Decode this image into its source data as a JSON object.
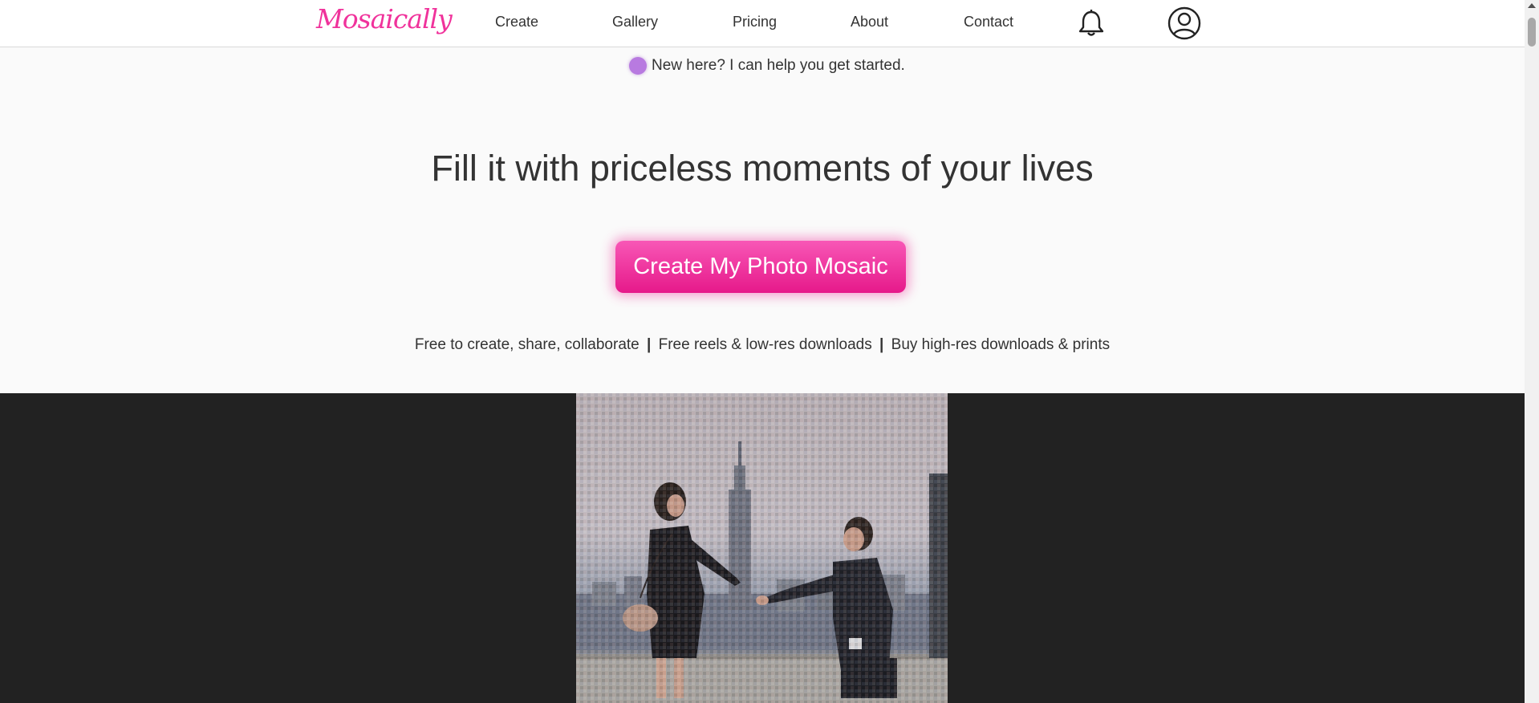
{
  "header": {
    "logo": "Mosaically",
    "nav": [
      {
        "label": "Create"
      },
      {
        "label": "Gallery"
      },
      {
        "label": "Pricing"
      },
      {
        "label": "About"
      },
      {
        "label": "Contact"
      }
    ],
    "icons": [
      "bell-icon",
      "user-account-icon"
    ]
  },
  "hero": {
    "helper_text": "New here? I can help you get started.",
    "headline": "Fill it with priceless moments of your lives",
    "cta_label": "Create My Photo Mosaic",
    "perks": [
      "Free to create, share, collaborate",
      "Free reels & low-res downloads",
      "Buy high-res downloads & prints"
    ],
    "perk_separator": "|"
  },
  "colors": {
    "brand_pink": "#f0329b",
    "helper_dot": "#b87ae0",
    "dark_band": "#222222",
    "page_bg": "#fafafa"
  }
}
